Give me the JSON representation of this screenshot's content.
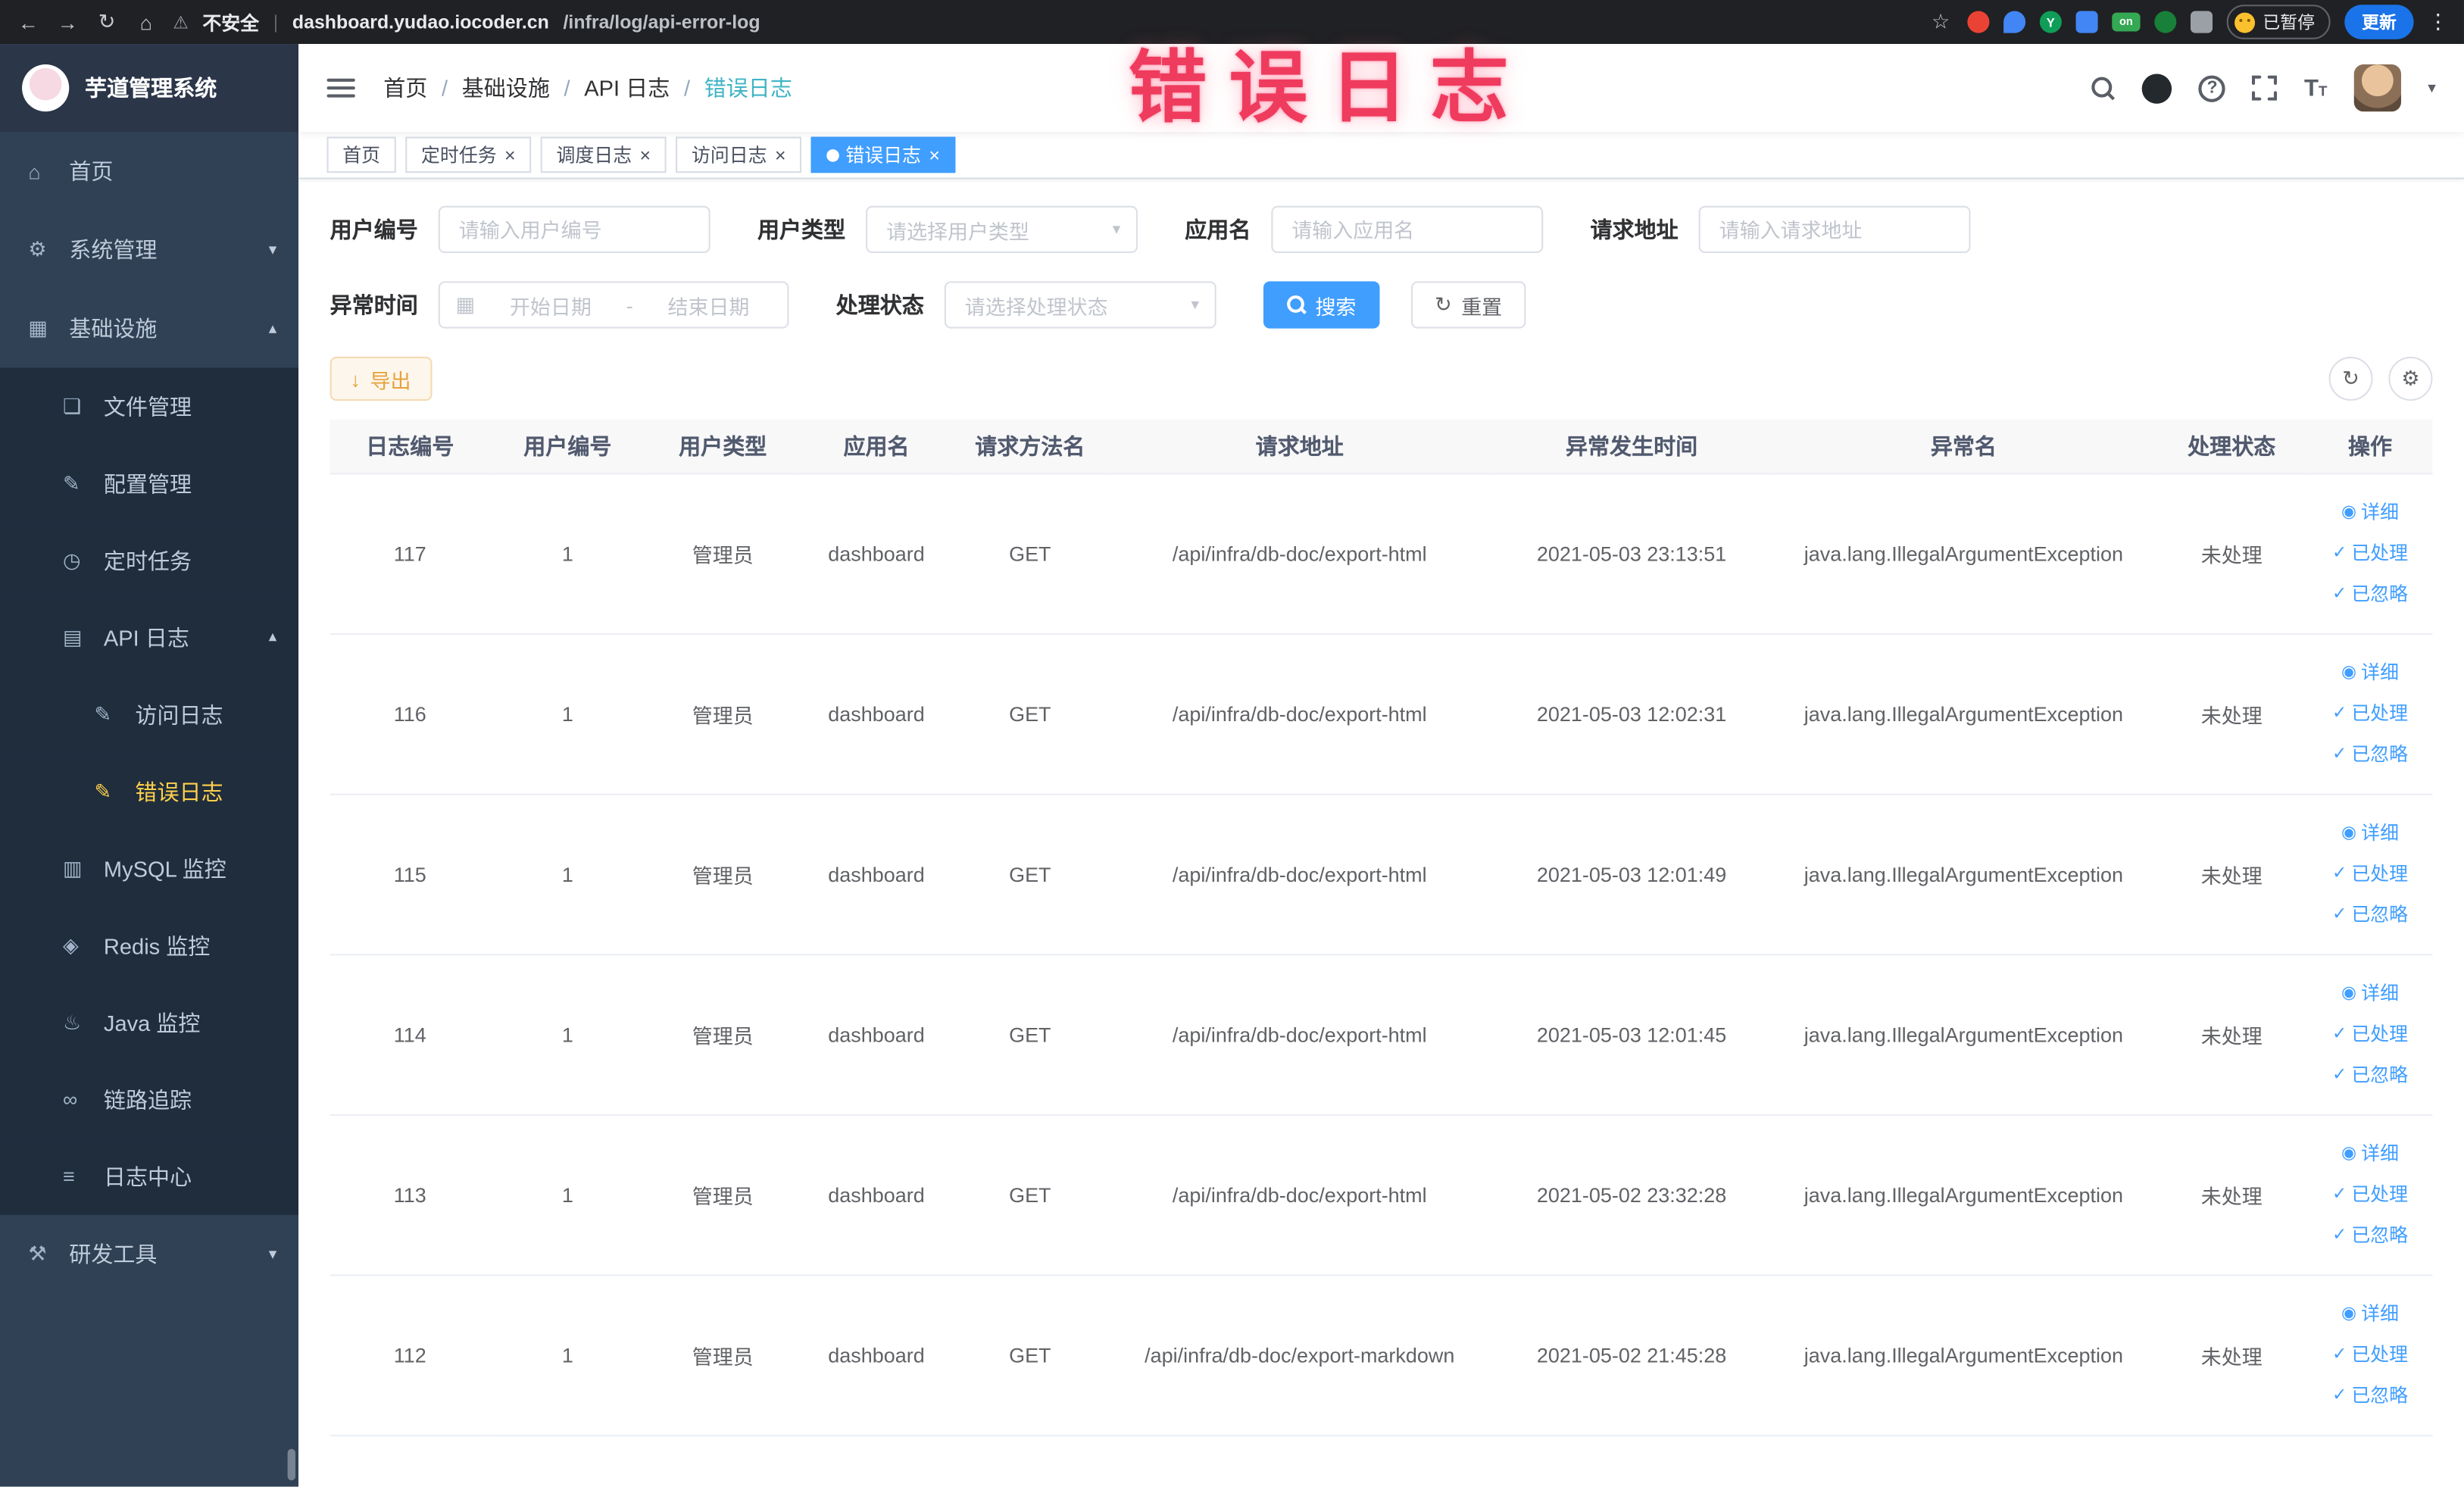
{
  "browser": {
    "security_label": "不安全",
    "url_domain": "dashboard.yudao.iocoder.cn",
    "url_path": "/infra/log/api-error-log",
    "paused_label": "已暂停",
    "update_label": "更新",
    "on_badge_label": "on",
    "ext_y_label": "Y"
  },
  "annotation": {
    "text": "错误日志"
  },
  "sidebar": {
    "logo_title": "芋道管理系统",
    "items": [
      {
        "label": "首页",
        "icon": "home-icon",
        "level": 0
      },
      {
        "label": "系统管理",
        "icon": "gear-icon",
        "level": 0,
        "chevron": "down"
      },
      {
        "label": "基础设施",
        "icon": "grid-icon",
        "level": 0,
        "chevron": "up"
      },
      {
        "label": "文件管理",
        "icon": "file-icon",
        "level": 1
      },
      {
        "label": "配置管理",
        "icon": "config-icon",
        "level": 1
      },
      {
        "label": "定时任务",
        "icon": "timer-icon",
        "level": 1
      },
      {
        "label": "API 日志",
        "icon": "api-log-icon",
        "level": 1,
        "chevron": "up"
      },
      {
        "label": "访问日志",
        "icon": "log-doc-icon",
        "level": 2
      },
      {
        "label": "错误日志",
        "icon": "log-doc-icon",
        "level": 2,
        "active": true
      },
      {
        "label": "MySQL 监控",
        "icon": "mysql-icon",
        "level": 1
      },
      {
        "label": "Redis 监控",
        "icon": "redis-icon",
        "level": 1
      },
      {
        "label": "Java 监控",
        "icon": "java-icon",
        "level": 1
      },
      {
        "label": "链路追踪",
        "icon": "trace-icon",
        "level": 1
      },
      {
        "label": "日志中心",
        "icon": "log-center-icon",
        "level": 1
      },
      {
        "label": "研发工具",
        "icon": "tools-icon",
        "level": 0,
        "chevron": "down"
      }
    ]
  },
  "header": {
    "breadcrumbs": [
      "首页",
      "基础设施",
      "API 日志",
      "错误日志"
    ],
    "breadcrumb_separator": "/"
  },
  "tabs": [
    {
      "label": "首页",
      "closable": false,
      "active": false
    },
    {
      "label": "定时任务",
      "closable": true,
      "active": false
    },
    {
      "label": "调度日志",
      "closable": true,
      "active": false
    },
    {
      "label": "访问日志",
      "closable": true,
      "active": false
    },
    {
      "label": "错误日志",
      "closable": true,
      "active": true
    }
  ],
  "filters": {
    "user_id": {
      "label": "用户编号",
      "placeholder": "请输入用户编号"
    },
    "user_type": {
      "label": "用户类型",
      "placeholder": "请选择用户类型"
    },
    "app_name": {
      "label": "应用名",
      "placeholder": "请输入应用名"
    },
    "request_url": {
      "label": "请求地址",
      "placeholder": "请输入请求地址"
    },
    "exception_time": {
      "label": "异常时间",
      "start_placeholder": "开始日期",
      "range_separator": "-",
      "end_placeholder": "结束日期"
    },
    "process_status": {
      "label": "处理状态",
      "placeholder": "请选择处理状态"
    },
    "search_label": "搜索",
    "reset_label": "重置"
  },
  "toolbar": {
    "export_label": "导出"
  },
  "table": {
    "headers": [
      "日志编号",
      "用户编号",
      "用户类型",
      "应用名",
      "请求方法名",
      "请求地址",
      "异常发生时间",
      "异常名",
      "处理状态",
      "操作"
    ],
    "actions": [
      {
        "label": "详细",
        "icon": "view-icon"
      },
      {
        "label": "已处理",
        "icon": "check-icon"
      },
      {
        "label": "已忽略",
        "icon": "check-icon"
      }
    ],
    "rows": [
      {
        "id": "117",
        "user_id": "1",
        "user_type": "管理员",
        "app": "dashboard",
        "method": "GET",
        "url": "/api/infra/db-doc/export-html",
        "time": "2021-05-03 23:13:51",
        "exception": "java.lang.IllegalArgumentException",
        "status": "未处理"
      },
      {
        "id": "116",
        "user_id": "1",
        "user_type": "管理员",
        "app": "dashboard",
        "method": "GET",
        "url": "/api/infra/db-doc/export-html",
        "time": "2021-05-03 12:02:31",
        "exception": "java.lang.IllegalArgumentException",
        "status": "未处理"
      },
      {
        "id": "115",
        "user_id": "1",
        "user_type": "管理员",
        "app": "dashboard",
        "method": "GET",
        "url": "/api/infra/db-doc/export-html",
        "time": "2021-05-03 12:01:49",
        "exception": "java.lang.IllegalArgumentException",
        "status": "未处理"
      },
      {
        "id": "114",
        "user_id": "1",
        "user_type": "管理员",
        "app": "dashboard",
        "method": "GET",
        "url": "/api/infra/db-doc/export-html",
        "time": "2021-05-03 12:01:45",
        "exception": "java.lang.IllegalArgumentException",
        "status": "未处理"
      },
      {
        "id": "113",
        "user_id": "1",
        "user_type": "管理员",
        "app": "dashboard",
        "method": "GET",
        "url": "/api/infra/db-doc/export-html",
        "time": "2021-05-02 23:32:28",
        "exception": "java.lang.IllegalArgumentException",
        "status": "未处理"
      },
      {
        "id": "112",
        "user_id": "1",
        "user_type": "管理员",
        "app": "dashboard",
        "method": "GET",
        "url": "/api/infra/db-doc/export-markdown",
        "time": "2021-05-02 21:45:28",
        "exception": "java.lang.IllegalArgumentException",
        "status": "未处理"
      }
    ]
  },
  "icons": {
    "back-icon": "←",
    "forward-icon": "→",
    "reload-icon": "↻",
    "browser-home-icon": "⌂",
    "warning-icon": "⚠",
    "star-icon": "☆",
    "dots-menu-icon": "⋮",
    "home-icon": "⌂",
    "gear-icon": "⚙",
    "grid-icon": "▦",
    "file-icon": "❏",
    "config-icon": "✎",
    "timer-icon": "◷",
    "api-log-icon": "▤",
    "log-doc-icon": "✎",
    "mysql-icon": "▥",
    "redis-icon": "◈",
    "java-icon": "♨",
    "trace-icon": "∞",
    "log-center-icon": "≡",
    "tools-icon": "⚒",
    "caret-down-icon": "▾",
    "chevron-up-icon": "▴",
    "chevron-down-icon": "▾",
    "calendar-icon": "▦",
    "close-icon": "×",
    "download-icon": "↓",
    "refresh-icon": "↻",
    "settings-icon": "⚙",
    "view-icon": "◉",
    "check-icon": "✓"
  },
  "colors": {
    "accent_blue": "#409eff",
    "active_tab_bg": "#409eff",
    "chrome_bar": "#202124",
    "sidebar_bg": "#304156",
    "submenu_bg": "#1f2d3d",
    "sidebar_active_text": "#ffd04b",
    "warning_btn_bg": "#fdf6ec",
    "warning_btn_border": "#f5dab1",
    "warning_btn_text": "#e6a23c",
    "annotation_red": "#ef3b5e",
    "breadcrumb_current": "#3fb4c4",
    "update_pill": "#1a73e8"
  }
}
